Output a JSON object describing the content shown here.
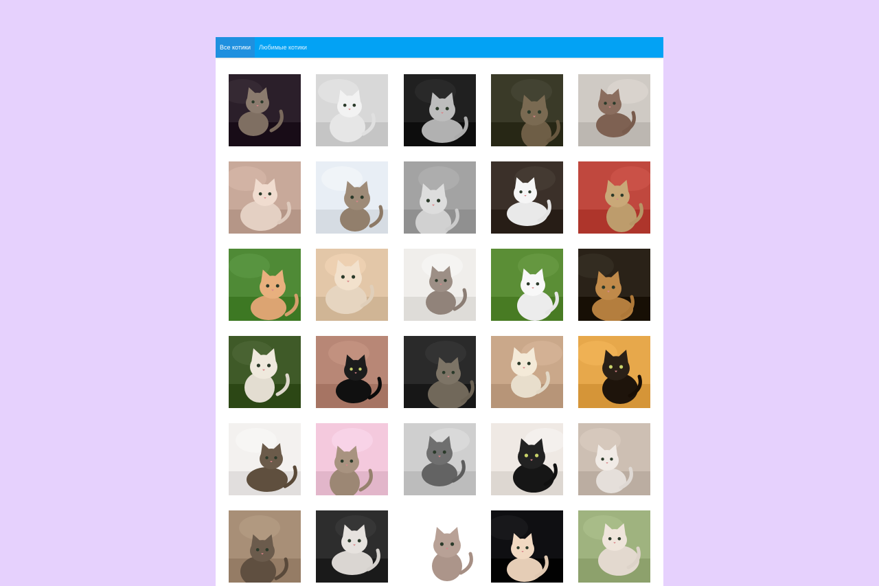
{
  "tabs": [
    {
      "label": "Все котики",
      "active": true
    },
    {
      "label": "Любимые котики",
      "active": false
    }
  ],
  "colors": {
    "page_background": "#e6d1fd",
    "tabbar": "#03a2f4",
    "tab_active": "#1f90df",
    "card_background": "#ffffff"
  },
  "cats": [
    {
      "name": "cat-photo-1",
      "bg": "#2b1f2a",
      "fg": "#8b7b6e",
      "scene": "purple-paws-closeup"
    },
    {
      "name": "cat-photo-2",
      "bg": "#d8d8d8",
      "fg": "#f2f2f2",
      "scene": "kitten-on-skateboard-bw"
    },
    {
      "name": "cat-photo-3",
      "bg": "#202020",
      "fg": "#bdbdbd",
      "scene": "yawning-cat-bw"
    },
    {
      "name": "cat-photo-4",
      "bg": "#3a3a28",
      "fg": "#7a6a52",
      "scene": "cat-on-couch"
    },
    {
      "name": "cat-photo-5",
      "bg": "#cfcac4",
      "fg": "#8a6d5e",
      "scene": "room-window"
    },
    {
      "name": "cat-photo-6",
      "bg": "#c8a99a",
      "fg": "#f0dccf",
      "scene": "cat-lying-floor"
    },
    {
      "name": "cat-photo-7",
      "bg": "#e8eef5",
      "fg": "#9e8b78",
      "scene": "surprised-cat-face"
    },
    {
      "name": "cat-photo-8",
      "bg": "#a3a3a3",
      "fg": "#dddddd",
      "scene": "cat-from-above-bw"
    },
    {
      "name": "cat-photo-9",
      "bg": "#3b3029",
      "fg": "#f5f5f5",
      "scene": "tuxedo-cat-standing"
    },
    {
      "name": "cat-photo-10",
      "bg": "#c0483e",
      "fg": "#c9a878",
      "scene": "cat-santa-hat"
    },
    {
      "name": "cat-photo-11",
      "bg": "#4f8a36",
      "fg": "#e8b07e",
      "scene": "ginger-kitten-grass"
    },
    {
      "name": "cat-photo-12",
      "bg": "#e3c7a8",
      "fg": "#f2e1cc",
      "scene": "cat-with-banana"
    },
    {
      "name": "cat-photo-13",
      "bg": "#f0eeeb",
      "fg": "#9d8f86",
      "scene": "cat-party-hat"
    },
    {
      "name": "cat-photo-14",
      "bg": "#5b8e36",
      "fg": "#f8f8f8",
      "scene": "white-fluffy-kitten"
    },
    {
      "name": "cat-photo-15",
      "bg": "#2a2218",
      "fg": "#c08a4a",
      "scene": "dog-and-kitten"
    },
    {
      "name": "cat-photo-16",
      "bg": "#3f5a28",
      "fg": "#efe9dd",
      "scene": "kitten-in-garden"
    },
    {
      "name": "cat-photo-17",
      "bg": "#b88776",
      "fg": "#1c1c1c",
      "scene": "sleeping-tuxedo-blanket"
    },
    {
      "name": "cat-photo-18",
      "bg": "#2a2a2a",
      "fg": "#7d7466",
      "scene": "grey-tabby-portrait"
    },
    {
      "name": "cat-photo-19",
      "bg": "#caa88a",
      "fg": "#f4ead8",
      "scene": "cat-on-lamp"
    },
    {
      "name": "cat-photo-20",
      "bg": "#e7a84b",
      "fg": "#2a2017",
      "scene": "cats-orange-wall"
    },
    {
      "name": "cat-photo-21",
      "bg": "#f3f1ef",
      "fg": "#6b5b4a",
      "scene": "cat-tiger-hat"
    },
    {
      "name": "cat-photo-22",
      "bg": "#f4c9dd",
      "fg": "#a89380",
      "scene": "kitten-pink-sheet"
    },
    {
      "name": "cat-photo-23",
      "bg": "#cfcfcf",
      "fg": "#6f6f6f",
      "scene": "sleeping-kitten-bw"
    },
    {
      "name": "cat-photo-24",
      "bg": "#efe9e4",
      "fg": "#222222",
      "scene": "calico-standing"
    },
    {
      "name": "cat-photo-25",
      "bg": "#cdbfb3",
      "fg": "#f1ebe6",
      "scene": "exotic-shorthair"
    },
    {
      "name": "cat-photo-26",
      "bg": "#a88f77",
      "fg": "#6b5b4c",
      "scene": "cat-lying-floor-2"
    },
    {
      "name": "cat-photo-27",
      "bg": "#2d2d2d",
      "fg": "#e6e2de",
      "scene": "blue-eyed-cat"
    },
    {
      "name": "cat-photo-28",
      "bg": "#ffffff",
      "fg": "#b8a196",
      "scene": "sphynx-cat"
    },
    {
      "name": "cat-photo-29",
      "bg": "#0f0f12",
      "fg": "#f1d9c2",
      "scene": "cream-cat-black-bg"
    },
    {
      "name": "cat-photo-30",
      "bg": "#9fb37f",
      "fg": "#efe5db",
      "scene": "cat-in-wreath"
    }
  ]
}
